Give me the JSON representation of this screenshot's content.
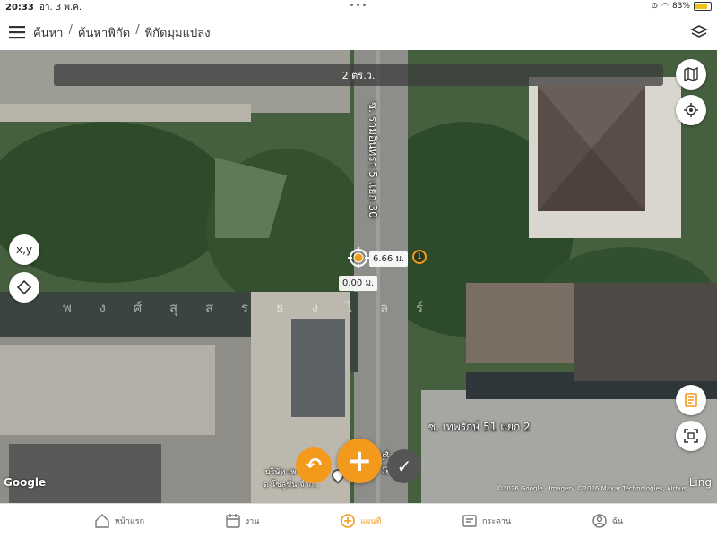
{
  "status": {
    "time": "20:33",
    "date": "อา. 3 พ.ค.",
    "battery": "83%",
    "battery_level": 0.83
  },
  "header": {
    "breadcrumb": [
      "ค้นหา",
      "ค้นหาพิกัด",
      "พิกัดมุมแปลง"
    ]
  },
  "map": {
    "distance_bar": "2 ตร.ว.",
    "xy_button": "x,y",
    "marker_distance": "6.66 ม.",
    "marker_origin": "0.00 ม.",
    "marker_number": "1",
    "road_vertical": "ซ. รามอินทรา 5 แยก 30",
    "road_horizontal": "ซ. เทพรักษ์ 51 แยก 2",
    "watermark_letters": "พ ง ศ์ สุ ส ร ธ ง ไ ล ร์",
    "poi_label_line1": "บริษัท เพ",
    "poi_label_line2": "ด โซลูชั่น จำกั..",
    "road_vertical_bottom": "ซ. โร",
    "google": "Google",
    "copyright": "©2026 Google · Imagery ©2026 Maxar Technologies, Airbus",
    "ling": "Ling"
  },
  "tabs": [
    {
      "label": "หน้าแรก",
      "icon": "home-icon",
      "active": false
    },
    {
      "label": "งาน",
      "icon": "calendar-icon",
      "active": false
    },
    {
      "label": "แผนที่",
      "icon": "add-circle-icon",
      "active": true
    },
    {
      "label": "กระดาน",
      "icon": "board-icon",
      "active": false
    },
    {
      "label": "ฉัน",
      "icon": "user-icon",
      "active": false
    }
  ],
  "colors": {
    "accent": "#f39a1c",
    "confirm": "#555555"
  }
}
